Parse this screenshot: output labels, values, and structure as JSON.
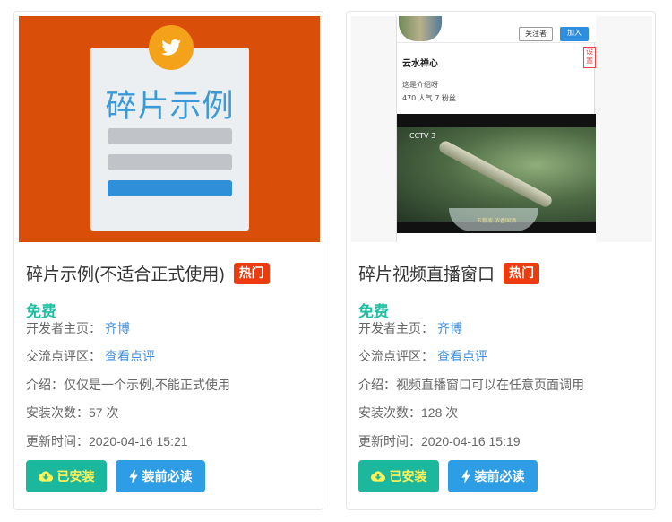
{
  "cards": [
    {
      "thumb": {
        "art_title": "碎片示例"
      },
      "title": "碎片示例(不适合正式使用)",
      "hot_badge": "热门",
      "price": "免费",
      "developer_label": "开发者主页：",
      "developer": "齐博",
      "review_label": "交流点评区：",
      "review_link": "查看点评",
      "intro": "介绍：仅仅是一个示例,不能正式使用",
      "installs": "安装次数：57 次",
      "updated": "更新时间：2020-04-16 15:21",
      "installed_label": "已安装",
      "read_label": "装前必读"
    },
    {
      "thumb": {
        "follow_label": "关注者",
        "join_label": "加入",
        "side_tag": "设置",
        "name": "云水禅心",
        "intro": "这是介绍呀",
        "stats": "470 人气   7 粉丝",
        "cctv": "CCTV 3",
        "caption": "五粮液 浓香国酒"
      },
      "title": "碎片视频直播窗口",
      "hot_badge": "热门",
      "price": "免费",
      "developer_label": "开发者主页：",
      "developer": "齐博",
      "review_label": "交流点评区：",
      "review_link": "查看点评",
      "intro": "介绍：视频直播窗口可以在任意页面调用",
      "installs": "安装次数：128 次",
      "updated": "更新时间：2020-04-16 15:19",
      "installed_label": "已安装",
      "read_label": "装前必读"
    }
  ],
  "colors": {
    "accent_green": "#1fbfa3",
    "hot_red": "#ec3b0c",
    "link_blue": "#3d8ed8",
    "installed_bg": "#1cb89d",
    "read_bg": "#2d9de5"
  },
  "icons": {
    "thumb1_badge": "twitter-bird-icon",
    "installed": "cloud-download-icon",
    "read": "lightning-icon"
  }
}
